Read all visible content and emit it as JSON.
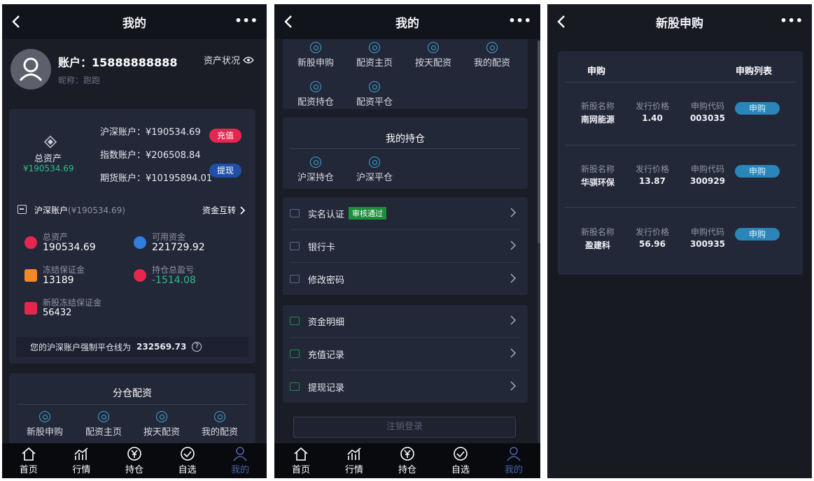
{
  "colors": {
    "accent_blue": "#2a86b8",
    "danger": "#e5274f",
    "positive": "#27c08a",
    "active_tab": "#4a63a8",
    "badge_green": "#1d8f3a"
  },
  "nav": {
    "more": "•••"
  },
  "tabbar": [
    {
      "label": "首页",
      "icon": "home-icon"
    },
    {
      "label": "行情",
      "icon": "chart-icon"
    },
    {
      "label": "持仓",
      "icon": "yen-icon"
    },
    {
      "label": "自选",
      "icon": "check-circle-icon"
    },
    {
      "label": "我的",
      "icon": "user-icon"
    }
  ],
  "screen1": {
    "title": "我的",
    "profile": {
      "account": "账户：15888888888",
      "nickname_label": "昵称：",
      "nickname": "跑跑",
      "asset_status": "资产状况"
    },
    "assets": {
      "total_label": "总资产",
      "total_value": "¥190534.69",
      "accounts": [
        {
          "label": "沪深账户：",
          "value": "¥190534.69"
        },
        {
          "label": "指数账户：",
          "value": "¥206508.84"
        },
        {
          "label": "期货账户：",
          "value": "¥10195894.01"
        }
      ],
      "recharge": "充值",
      "withdraw": "提现"
    },
    "hs_account": {
      "label": "沪深账户",
      "sub": "(¥190534.69)",
      "transfer": "资金互转",
      "items": [
        {
          "label": "总资产",
          "value": "190534.69"
        },
        {
          "label": "可用资金",
          "value": "221729.92"
        },
        {
          "label": "冻结保证金",
          "value": "13189"
        },
        {
          "label": "持仓总盈亏",
          "value": "-1514.08"
        },
        {
          "label": "新股冻结保证金",
          "value": "56432"
        }
      ],
      "liquidation_label": "您的沪深账户强制平仓线为",
      "liquidation_value": "232569.73"
    },
    "allocation": {
      "title": "分仓配资",
      "items": [
        "新股申购",
        "配资主页",
        "按天配资",
        "我的配资"
      ]
    }
  },
  "screen2": {
    "title": "我的",
    "top_items": [
      "新股申购",
      "配资主页",
      "按天配资",
      "我的配资",
      "配资持仓",
      "配资平仓"
    ],
    "holdings": {
      "title": "我的持仓",
      "items": [
        "沪深持仓",
        "沪深平仓"
      ]
    },
    "menu1": [
      {
        "label": "实名认证",
        "badge": "审核通过"
      },
      {
        "label": "银行卡"
      },
      {
        "label": "修改密码"
      }
    ],
    "menu2": [
      {
        "label": "资金明细"
      },
      {
        "label": "充值记录"
      },
      {
        "label": "提现记录"
      }
    ],
    "logout": "注销登录"
  },
  "screen3": {
    "title": "新股申购",
    "header_left": "申购",
    "header_right": "申购列表",
    "col_labels": {
      "name": "新股名称",
      "price": "发行价格",
      "code": "申购代码"
    },
    "button": "申购",
    "stocks": [
      {
        "name": "南网能源",
        "price": "1.40",
        "code": "003035"
      },
      {
        "name": "华骐环保",
        "price": "13.87",
        "code": "300929"
      },
      {
        "name": "盈建科",
        "price": "56.96",
        "code": "300935"
      }
    ]
  }
}
